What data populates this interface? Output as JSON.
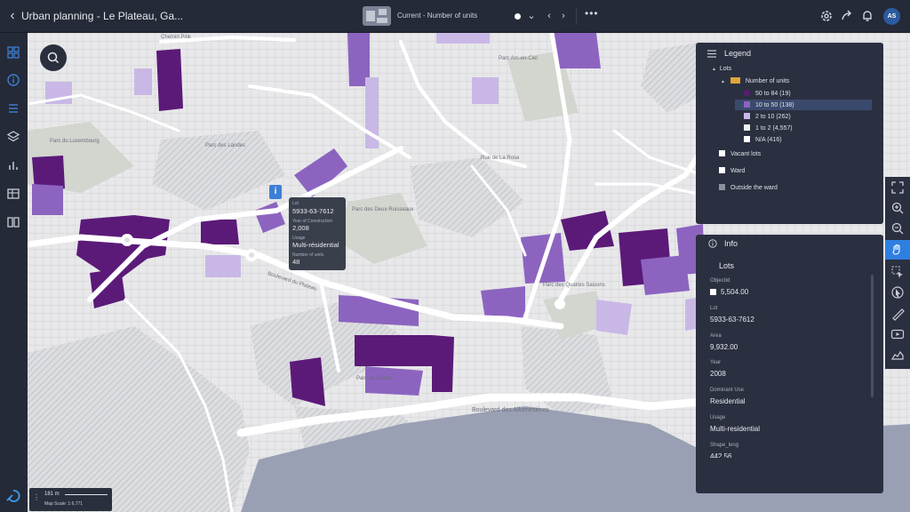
{
  "header": {
    "title": "Urban planning - Le Plateau, Ga...",
    "view_label": "Current - Number of units",
    "avatar_initials": "AS"
  },
  "map": {
    "place_labels": {
      "chemin_pink": "Chemin Pink",
      "parc_luxembourg": "Parc du Luxembourg",
      "parc_landes": "Parc des Landes",
      "parc_arc_en_ciel": "Parc Arc-en-Ciel",
      "parc_deux_ruisseaux": "Parc des Deux-Ruisseaux",
      "parc_quatres_saisons": "Parc des Quatres Saisons",
      "parc_riviere": "Parc de Riviere",
      "rue_la_rose": "Rue de La Rose",
      "boulevard_plateau": "Boulevard du Plateau",
      "boulevard_allumettieres": "Boulevard des Allumettières"
    }
  },
  "tooltip": {
    "lot_label": "Lot",
    "lot_value": "5933-63-7612",
    "year_label": "Year of Construction",
    "year_value": "2,008",
    "usage_label": "Usage",
    "usage_value": "Multi-résidential",
    "units_label": "Number of units",
    "units_value": "48"
  },
  "scale": {
    "distance": "181 m",
    "map_scale": "Map Scale: 1:6,771"
  },
  "legend": {
    "title": "Legend",
    "group": "Lots",
    "subgroup": "Number of units",
    "classes": [
      {
        "label": "50 to 84 (19)",
        "color": "#5b1a78"
      },
      {
        "label": "10 to 50 (138)",
        "color": "#8c64c0"
      },
      {
        "label": "2 to 10 (262)",
        "color": "#c9b8e6"
      },
      {
        "label": "1 to 2 (4,557)",
        "color": "#f2f2f2"
      },
      {
        "label": "N/A (416)",
        "color": "#ffffff"
      }
    ],
    "vacant": "Vacant lots",
    "ward": "Ward",
    "outside": "Outside the ward"
  },
  "info": {
    "title": "Info",
    "section": "Lots",
    "fields": [
      {
        "label": "ObjectId",
        "value": "5,504.00"
      },
      {
        "label": "Lot",
        "value": "5933-63-7612"
      },
      {
        "label": "Area",
        "value": "9,932.00"
      },
      {
        "label": "Year",
        "value": "2008"
      },
      {
        "label": "Dominant Use",
        "value": "Residential"
      },
      {
        "label": "Usage",
        "value": "Multi-residential"
      },
      {
        "label": "Shape_leng",
        "value": "442.56"
      }
    ]
  },
  "colors": {
    "panel_bg": "#2b3040",
    "header_bg": "#252a38",
    "accent": "#2f7fe0",
    "dark_purple": "#5b1a78",
    "mid_purple": "#8c64c0",
    "light_purple": "#c9b8e6",
    "water": "#9aa0b4",
    "road": "#ffffff"
  }
}
